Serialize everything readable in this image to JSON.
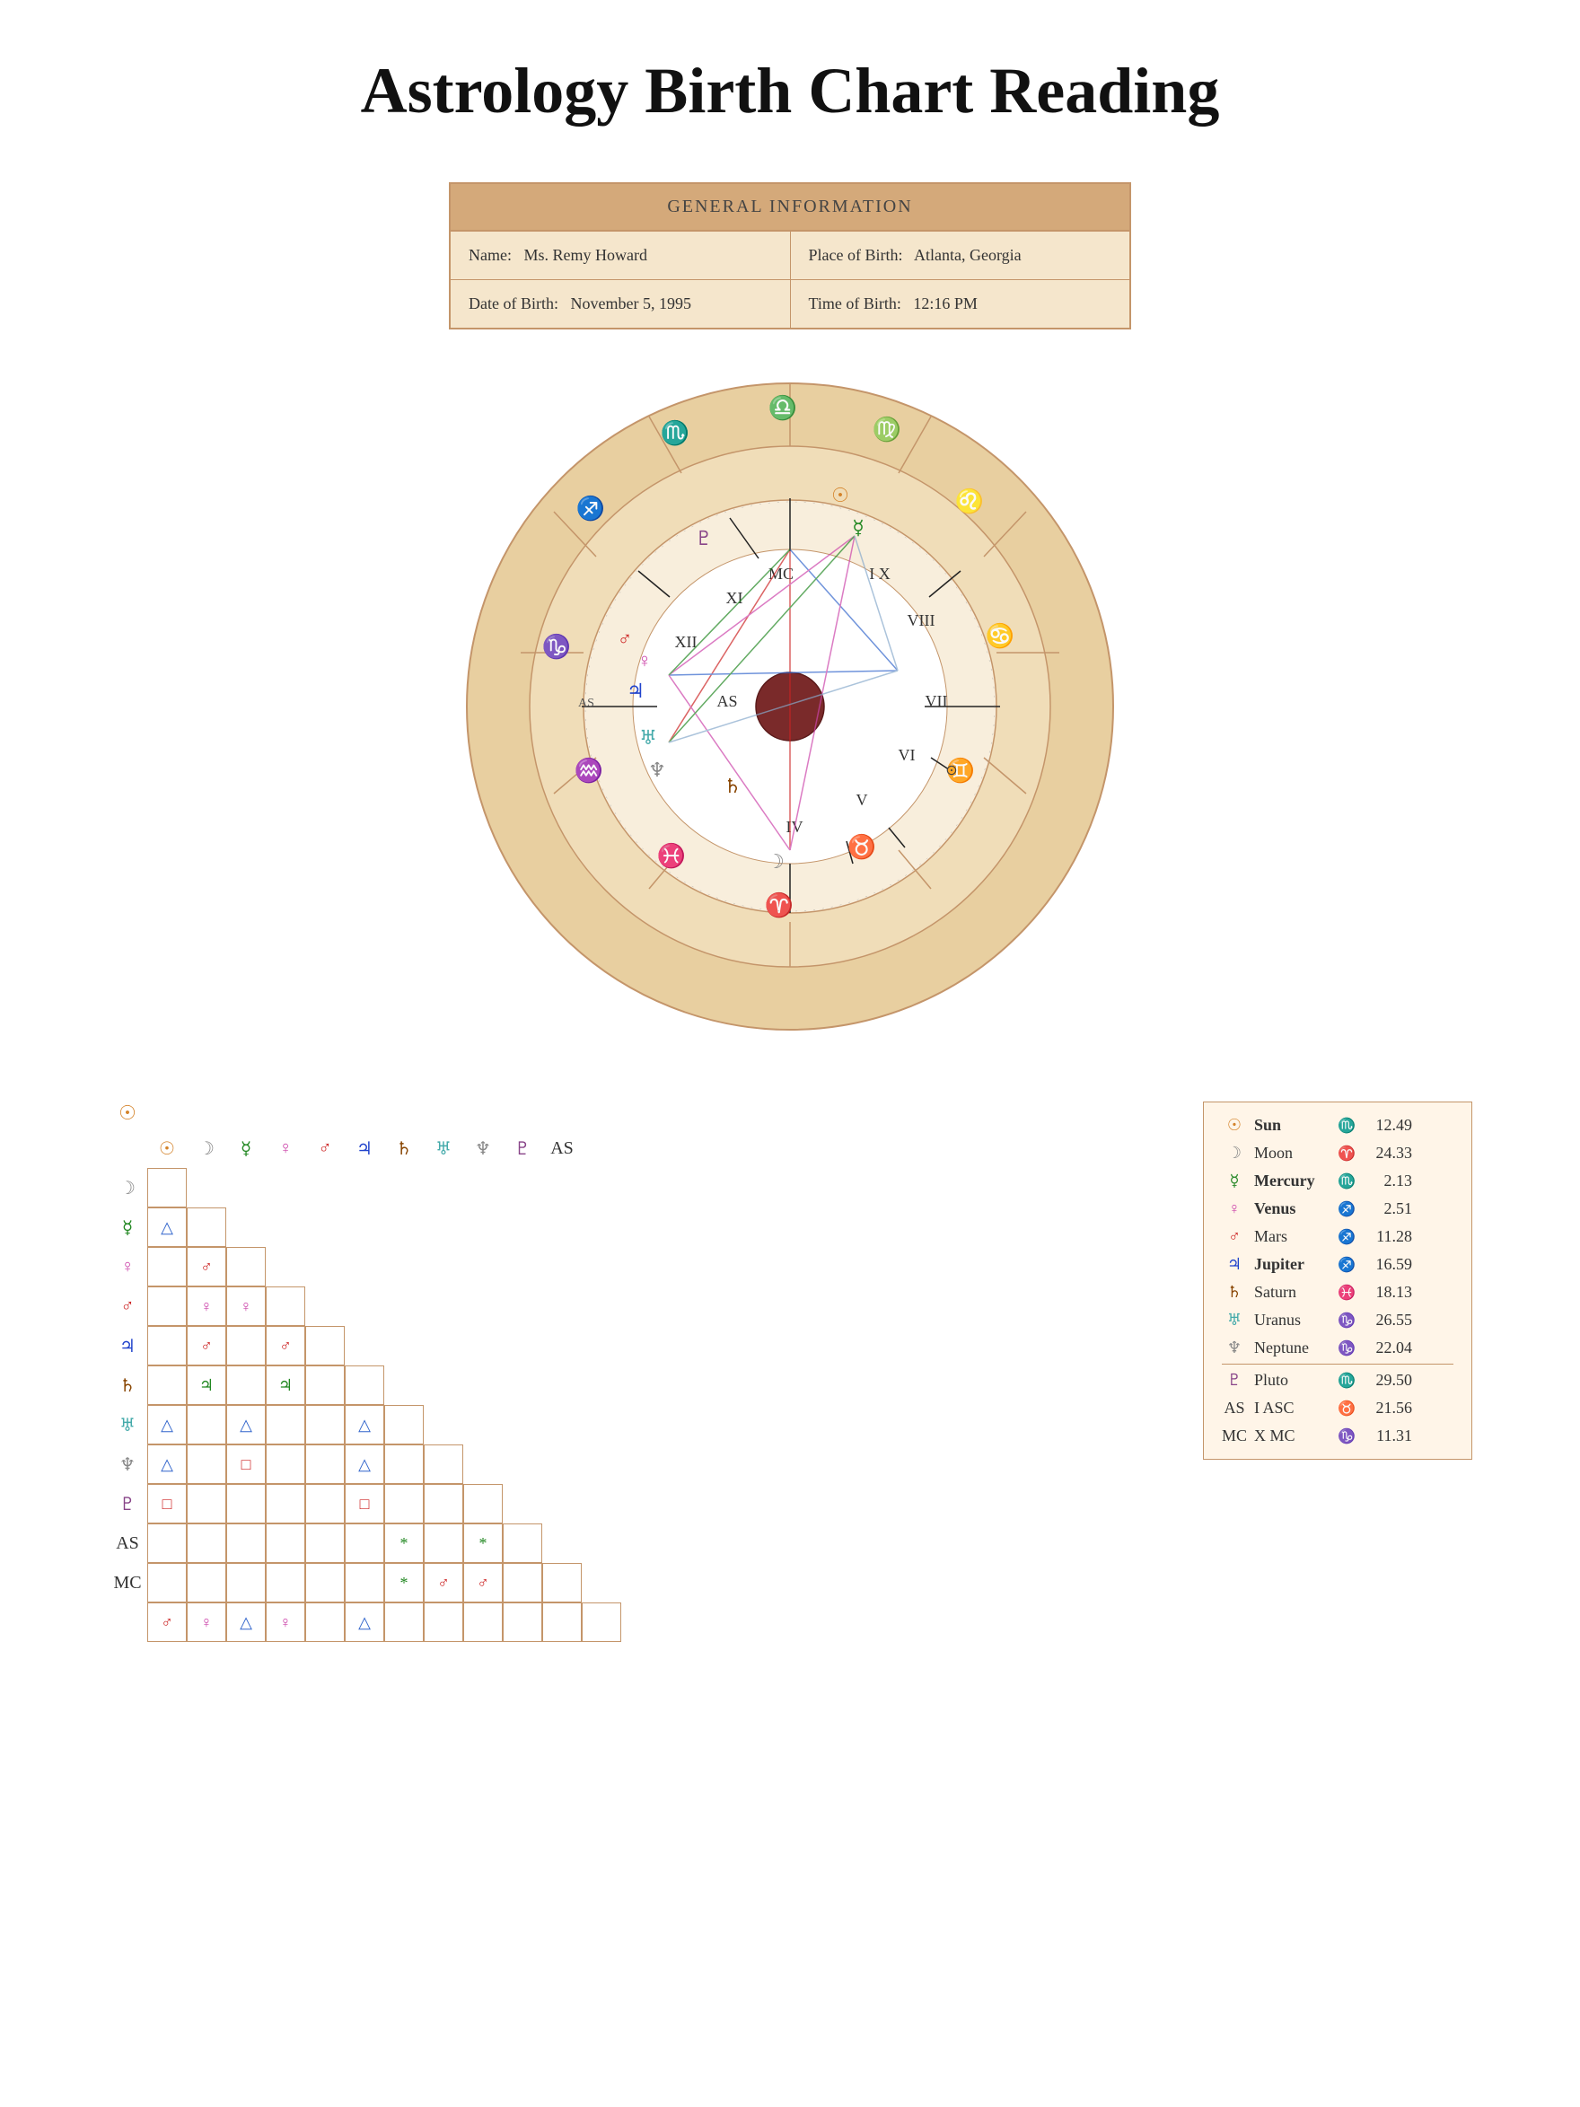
{
  "title": "Astrology Birth Chart Reading",
  "general_info": {
    "header": "GENERAL INFORMATION",
    "name_label": "Name:",
    "name_value": "Ms. Remy Howard",
    "place_label": "Place of Birth:",
    "place_value": "Atlanta, Georgia",
    "dob_label": "Date of Birth:",
    "dob_value": "November 5, 1995",
    "tob_label": "Time of Birth:",
    "tob_value": "12:16 PM"
  },
  "planets": [
    {
      "symbol": "☉",
      "color": "sun-color",
      "name": "Sun",
      "bold": true,
      "sign": "♏",
      "sign_color": "mars-color",
      "deg": "12.49"
    },
    {
      "symbol": "☽",
      "color": "moon-color",
      "name": "Moon",
      "bold": false,
      "sign": "♈",
      "sign_color": "mars-color",
      "deg": "24.33"
    },
    {
      "symbol": "☿",
      "color": "mercury-color",
      "name": "Mercury",
      "bold": true,
      "sign": "♏",
      "sign_color": "mars-color",
      "deg": "2.13"
    },
    {
      "symbol": "♀",
      "color": "venus-color",
      "name": "Venus",
      "bold": true,
      "sign": "♐",
      "sign_color": "jupiter-color",
      "deg": "2.51"
    },
    {
      "symbol": "♂",
      "color": "mars-color",
      "name": "Mars",
      "bold": false,
      "sign": "♐",
      "sign_color": "jupiter-color",
      "deg": "11.28"
    },
    {
      "symbol": "♃",
      "color": "jupiter-color",
      "name": "Jupiter",
      "bold": true,
      "sign": "♐",
      "sign_color": "jupiter-color",
      "deg": "16.59"
    },
    {
      "symbol": "♄",
      "color": "saturn-color",
      "name": "Saturn",
      "bold": false,
      "sign": "♓",
      "sign_color": "neptune-color",
      "deg": "18.13"
    },
    {
      "symbol": "♅",
      "color": "uranus-color",
      "name": "Uranus",
      "bold": false,
      "sign": "♑",
      "sign_color": "saturn-color",
      "deg": "26.55"
    },
    {
      "symbol": "♆",
      "color": "neptune-color",
      "name": "Neptune",
      "bold": false,
      "sign": "♑",
      "sign_color": "saturn-color",
      "deg": "22.04"
    },
    {
      "symbol": "♇",
      "color": "pluto-color",
      "name": "Pluto",
      "bold": false,
      "sign": "♏",
      "sign_color": "mars-color",
      "deg": "29.50"
    },
    {
      "symbol": "AS",
      "color": "as-color",
      "name": "I ASC",
      "bold": false,
      "sign": "♉",
      "sign_color": "venus-color",
      "deg": "21.56"
    },
    {
      "symbol": "MC",
      "color": "mc-color",
      "name": "X MC",
      "bold": false,
      "sign": "♑",
      "sign_color": "saturn-color",
      "deg": "11.31"
    }
  ],
  "aspect_grid": {
    "row_headers": [
      "☉",
      "☽",
      "☿",
      "♀",
      "♂",
      "♃",
      "♄",
      "♅",
      "♆",
      "♇",
      "AS",
      "MC"
    ],
    "aspects": [
      [
        null
      ],
      [
        "△",
        ""
      ],
      [
        "",
        "♂",
        ""
      ],
      [
        "",
        "♀",
        "♀",
        ""
      ],
      [
        "",
        "♂",
        "",
        "♂",
        ""
      ],
      [
        "",
        "♃",
        "",
        "♃",
        "",
        ""
      ],
      [
        "△",
        "",
        "△",
        "",
        "",
        "△",
        ""
      ],
      [
        "△",
        "",
        "□",
        "",
        "",
        "△",
        "",
        ""
      ],
      [
        "□",
        "",
        "",
        "",
        "",
        "□",
        "",
        ""
      ],
      [
        "",
        "",
        "",
        "",
        "",
        "",
        "*",
        "",
        "*",
        ""
      ],
      [
        "",
        "",
        "",
        "",
        "",
        "",
        "*",
        "♂",
        "♂",
        "",
        ""
      ],
      [
        "♂",
        "♀",
        "△",
        "♀",
        "",
        "△",
        "",
        "",
        "",
        "",
        "",
        ""
      ]
    ]
  },
  "zodiac_symbols": {
    "aries": "♈",
    "taurus": "♉",
    "gemini": "♊",
    "cancer": "♋",
    "leo": "♌",
    "virgo": "♍",
    "libra": "♎",
    "scorpio": "♏",
    "sagittarius": "♐",
    "capricorn": "♑",
    "aquarius": "♒",
    "pisces": "♓"
  }
}
